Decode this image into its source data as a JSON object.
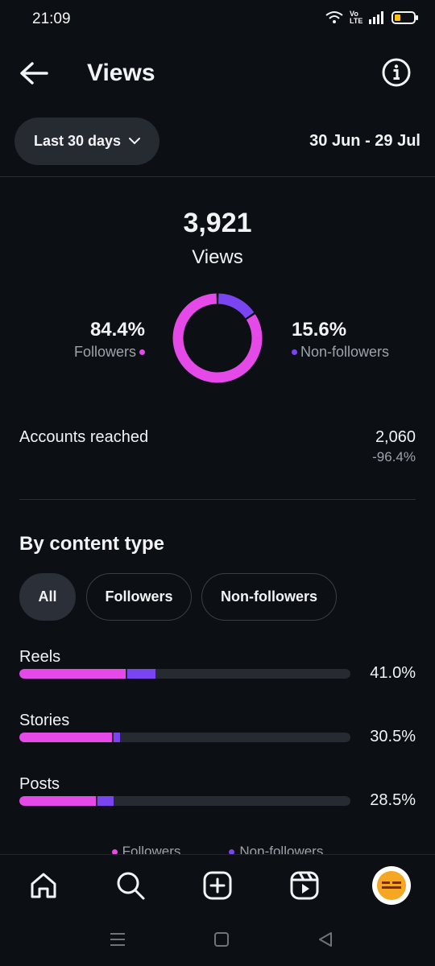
{
  "status": {
    "time": "21:09",
    "network": "Vo LTE"
  },
  "header": {
    "title": "Views"
  },
  "filter": {
    "range_label": "Last 30 days",
    "date_range": "30 Jun - 29 Jul"
  },
  "summary": {
    "total": "3,921",
    "total_label": "Views",
    "followers_pct": "84.4%",
    "followers_label": "Followers",
    "followers_fraction": 0.844,
    "nonfollowers_pct": "15.6%",
    "nonfollowers_label": "Non-followers",
    "nonfollowers_fraction": 0.156
  },
  "accounts_reached": {
    "label": "Accounts reached",
    "value": "2,060",
    "change": "-96.4%"
  },
  "content_type": {
    "title": "By content type",
    "chips": [
      {
        "label": "All",
        "selected": true
      },
      {
        "label": "Followers",
        "selected": false
      },
      {
        "label": "Non-followers",
        "selected": false
      }
    ],
    "rows": [
      {
        "label": "Reels",
        "pct": "41.0%",
        "followers": 0.32,
        "nonfollowers": 0.09
      },
      {
        "label": "Stories",
        "pct": "30.5%",
        "followers": 0.28,
        "nonfollowers": 0.025
      },
      {
        "label": "Posts",
        "pct": "28.5%",
        "followers": 0.23,
        "nonfollowers": 0.055
      }
    ],
    "legend": {
      "followers": "Followers",
      "nonfollowers": "Non-followers"
    }
  },
  "colors": {
    "followers": "#e54ae8",
    "nonfollowers": "#7a44f0",
    "background": "#0c0f14"
  },
  "nav": {
    "items": [
      {
        "icon": "home-icon"
      },
      {
        "icon": "search-icon"
      },
      {
        "icon": "create-icon"
      },
      {
        "icon": "reels-icon"
      },
      {
        "icon": "profile-avatar"
      }
    ]
  }
}
